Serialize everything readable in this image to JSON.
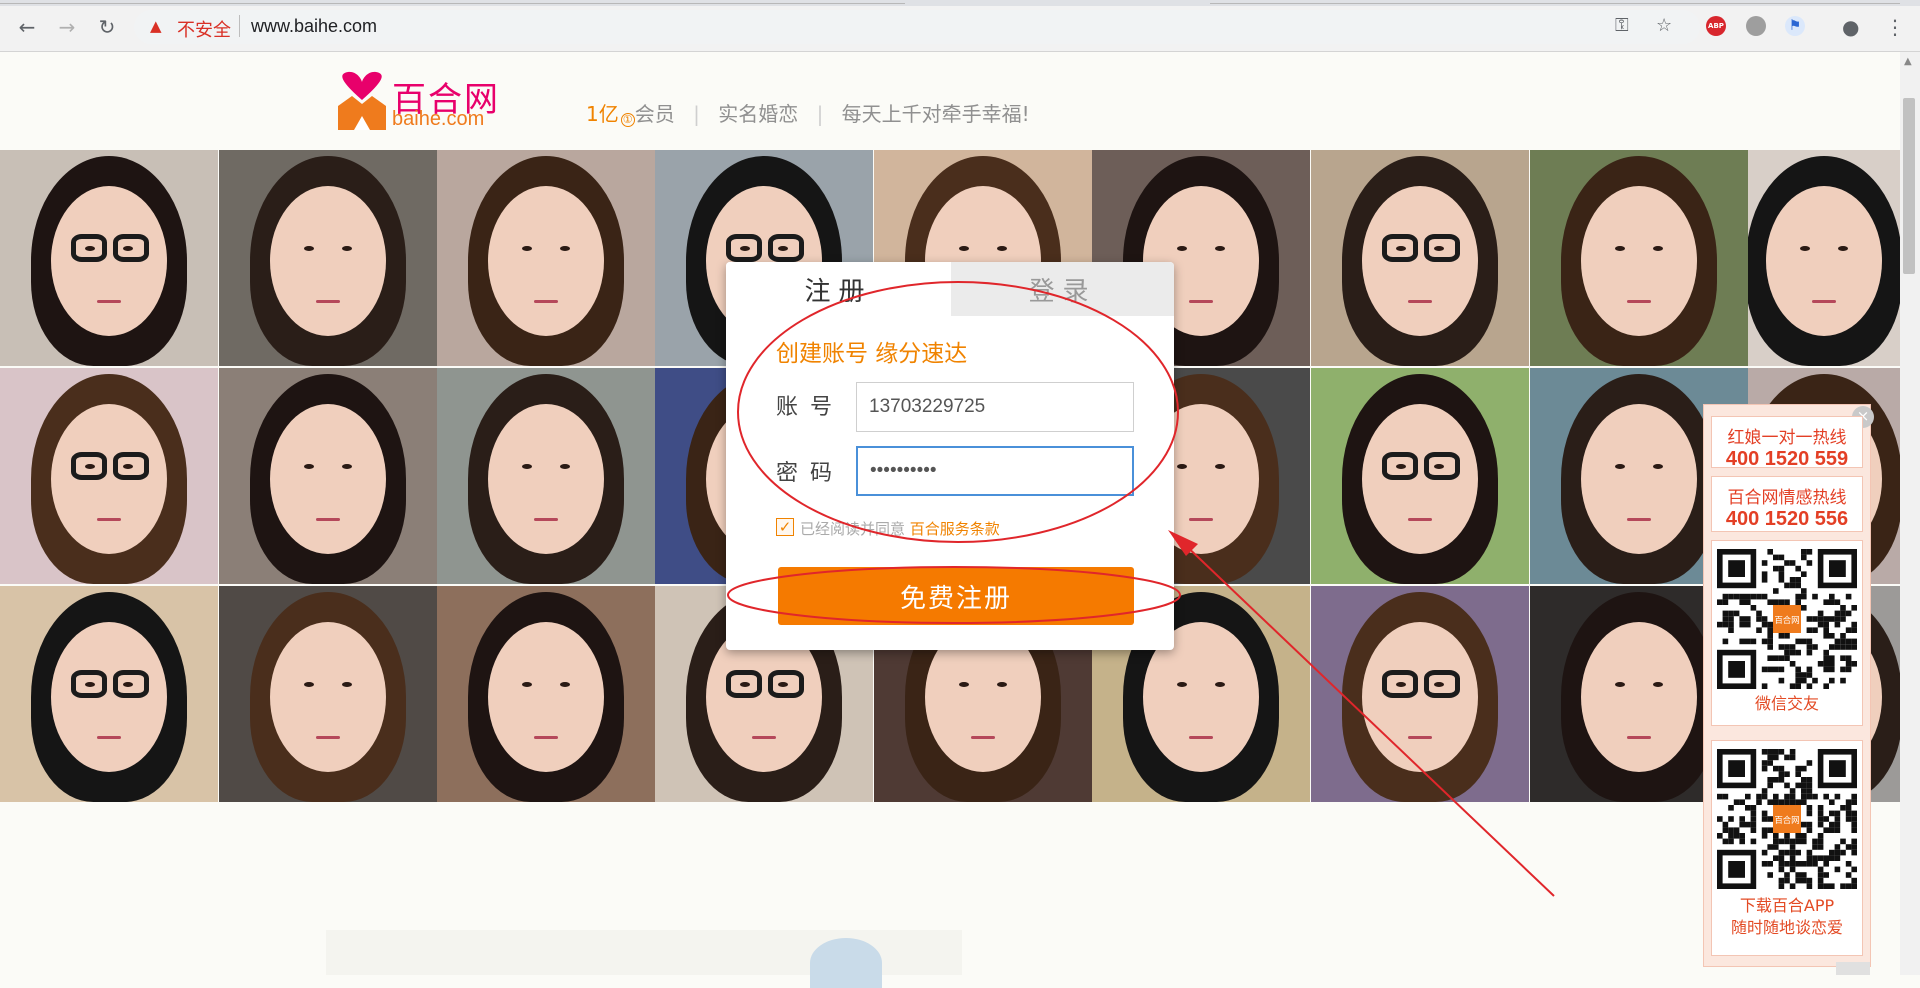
{
  "browser": {
    "insecure_label": "不安全",
    "url": "www.baihe.com",
    "extension_abp": "ABP"
  },
  "header": {
    "logo_cn": "百合网",
    "logo_en": "baihe.com",
    "slogan_count": "1亿",
    "slogan_sup": "①",
    "slogan_members": "会员",
    "slogan_realname": "实名婚恋",
    "slogan_daily": "每天上千对牵手幸福!"
  },
  "form": {
    "tab_register": "注册",
    "tab_login": "登录",
    "heading": "创建账号  缘分速达",
    "account_label": "账号",
    "account_value": "13703229725",
    "password_label": "密码",
    "password_value": "••••••••••",
    "agree_check": "✓",
    "agree_text": "已经阅读并同意 ",
    "agree_link": "百合服务条款",
    "submit_label": "免费注册"
  },
  "side_panel": {
    "close": "×",
    "hotline1_title": "红娘一对一热线",
    "hotline1_number": "400 1520 559",
    "hotline2_title": "百合网情感热线",
    "hotline2_number": "400 1520 556",
    "qr1_caption": "微信交友",
    "qr2_caption_line1": "下载百合APP",
    "qr2_caption_line2": "随时随地谈恋爱",
    "qr_logo": "百合网"
  },
  "colors": {
    "brand_orange": "#f57a00",
    "brand_pink": "#e8006b",
    "annotation_red": "#e0262b",
    "hotline_red": "#e33f25"
  }
}
